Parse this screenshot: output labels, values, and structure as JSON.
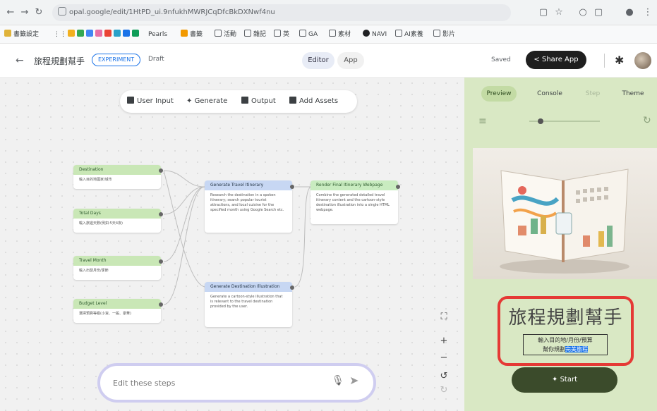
{
  "browser": {
    "url": "opal.google/edit/1HtPD_ui.9nfukhMWRJCqDfcBkDXNwf4nu",
    "bookmarks": [
      "書籤設定",
      "Pearls",
      "書籤",
      "活動",
      "雜記",
      "英",
      "GA",
      "素材",
      "NAVI",
      "AI素養",
      "影片"
    ]
  },
  "header": {
    "back": "←",
    "title": "旅程規劃幫手",
    "tag": "EXPERIMENT",
    "status": "Draft",
    "editor_label": "Editor",
    "app_label": "App",
    "saved_label": "Saved",
    "share_label": "Share App"
  },
  "toolbar": {
    "user_input": "User Input",
    "generate": "Generate",
    "output": "Output",
    "add_assets": "Add Assets"
  },
  "nodes": {
    "destination": {
      "title": "Destination",
      "body": "輸入目的地國家/城市"
    },
    "trip_days": {
      "title": "Total Days",
      "body": "輸入旅遊天數(例如:5天4夜)"
    },
    "travel_month": {
      "title": "Travel Month",
      "body": "輸入出發月份/季節"
    },
    "budget_level": {
      "title": "Budget Level",
      "body": "選擇預算等級(小資、一般、豪華)"
    },
    "gen_itinerary": {
      "title": "Generate Travel Itinerary",
      "body": "Research the destination in a spoken itinerary; search popular tourist attractions, and local cuisine for the specified month using Google Search etc."
    },
    "gen_illustration": {
      "title": "Generate Destination Illustration",
      "body": "Generate a cartoon-style illustration that is relevant to the travel destination provided by the user."
    },
    "render": {
      "title": "Render Final Itinerary Webpage",
      "body": "Combine the generated detailed travel itinerary content and the cartoon-style destination illustration into a single HTML webpage."
    }
  },
  "editbox": {
    "placeholder": "Edit these steps"
  },
  "panel": {
    "tabs": [
      "Preview",
      "Console",
      "Step",
      "Theme"
    ],
    "app_title": "旅程規劃幫手",
    "subtitle_line1": "輸入目的地/月份/預算",
    "subtitle_line2a": "幫你規劃",
    "subtitle_line2b": "完美旅程",
    "start_label": "Start"
  },
  "colors": {
    "panel_bg": "#d9e8c4",
    "highlight_frame": "#e53935",
    "start_button": "#3b4b2b"
  }
}
